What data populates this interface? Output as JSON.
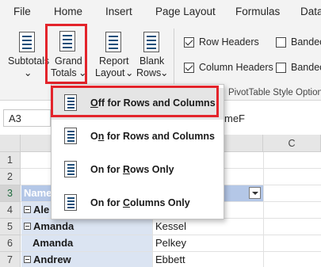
{
  "tabs": [
    "File",
    "Home",
    "Insert",
    "Page Layout",
    "Formulas",
    "Data"
  ],
  "ribbon": {
    "subtotals": {
      "line1": "Subtotals",
      "arrow": "⌄"
    },
    "grand_totals": {
      "line1": "Grand",
      "line2": "Totals",
      "arrow": "⌄"
    },
    "report_layout": {
      "line1": "Report",
      "line2": "Layout",
      "arrow": "⌄"
    },
    "blank_rows": {
      "line1": "Blank",
      "line2": "Rows",
      "arrow": "⌄"
    },
    "row_headers": {
      "label": "Row Headers",
      "checked": true
    },
    "column_headers": {
      "label": "Column Headers",
      "checked": true
    },
    "banded_rows": {
      "label": "Bandec",
      "checked": false
    },
    "banded_columns": {
      "label": "Bandec",
      "checked": false
    },
    "style_options_group": "PivotTable Style Option"
  },
  "formula_bar": {
    "name_box": "A3",
    "formula_fragment": "meF"
  },
  "columns": [
    "C"
  ],
  "rows": [
    "1",
    "2",
    "3",
    "4",
    "5",
    "6",
    "7"
  ],
  "cells": {
    "a3": "Name",
    "a4": "Ale",
    "a5": "Amanda",
    "b5": "Kessel",
    "a6": "Amanda",
    "b6": "Pelkey",
    "a7": "Andrew",
    "b7": "Ebbett"
  },
  "dropdown": {
    "items": [
      {
        "pre": "",
        "u": "O",
        "post": "ff for Rows and Columns",
        "full": "Off for Rows and Columns"
      },
      {
        "pre": "O",
        "u": "n",
        "post": " for Rows and Columns",
        "full": "On for Rows and Columns"
      },
      {
        "pre": "On for ",
        "u": "R",
        "post": "ows Only",
        "full": "On for Rows Only"
      },
      {
        "pre": "On for ",
        "u": "C",
        "post": "olumns Only",
        "full": "On for Columns Only"
      }
    ],
    "highlighted_index": 0
  },
  "colors": {
    "highlight_red": "#e3242b",
    "accent_blue": "#b4c7e7",
    "row_band": "#dbe4f2"
  }
}
